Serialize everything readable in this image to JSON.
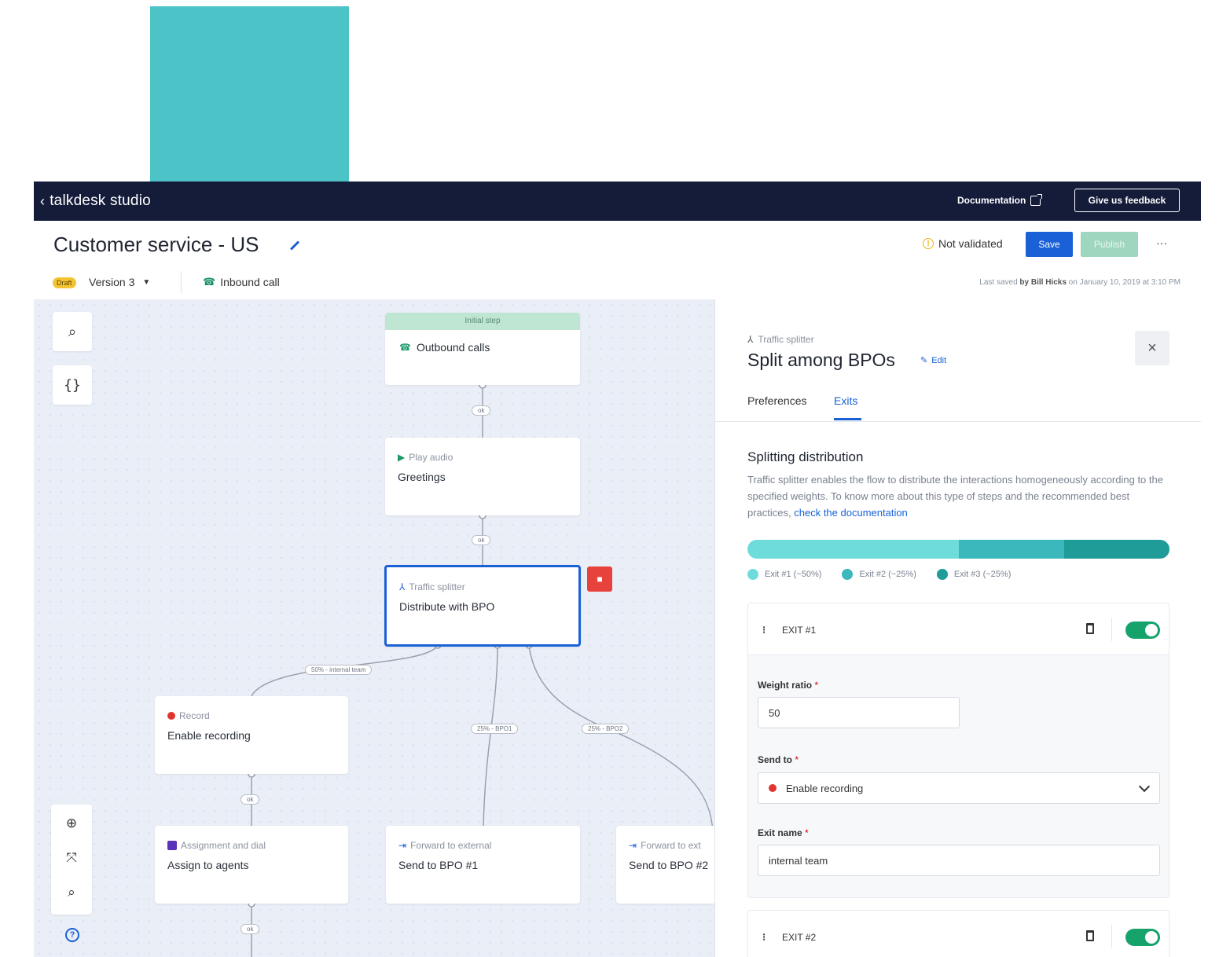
{
  "topbar": {
    "brand": "talkdesk studio",
    "documentation_label": "Documentation",
    "feedback_label": "Give us feedback"
  },
  "header": {
    "title": "Customer service - US",
    "validation_status": "Not validated",
    "save_label": "Save",
    "publish_label": "Publish",
    "more_label": "···",
    "draft_badge": "Draft",
    "version_label": "Version 3",
    "trigger_label": "Inbound call",
    "last_saved_prefix": "Last saved",
    "last_saved_by": "by Bill Hicks",
    "last_saved_when": "on January 10, 2019 at 3:10 PM"
  },
  "colors": {
    "topbar_bg": "#141c3a",
    "accent_blue": "#1a61d8",
    "canvas_bg": "#eaeef6",
    "teal_block": "#4bc3c7",
    "exit1": "#6fdcdc",
    "exit2": "#3bb8bc",
    "exit3": "#1f9c97",
    "toggle_on": "#16a36b",
    "danger": "#e8423d"
  },
  "canvas": {
    "tools": {
      "search_icon": "⌕",
      "variables_icon": "{}",
      "zoom_in_icon": "⊕",
      "fit_icon": "⤧",
      "zoom_out_icon": "⌕",
      "help_icon": "?"
    },
    "nodes": {
      "initial": {
        "header": "Initial step",
        "label": "Outbound calls"
      },
      "play_audio": {
        "type": "Play audio",
        "label": "Greetings"
      },
      "splitter": {
        "type": "Traffic splitter",
        "label": "Distribute with BPO"
      },
      "record": {
        "type": "Record",
        "label": "Enable recording"
      },
      "assign": {
        "type": "Assignment and dial",
        "label": "Assign to agents"
      },
      "forward1": {
        "type": "Forward to external",
        "label": "Send to BPO #1"
      },
      "forward2": {
        "type": "Forward to ext",
        "label": "Send to BPO #2"
      }
    },
    "edge_labels": {
      "ok1": "ok",
      "ok2": "ok",
      "ok3": "ok",
      "ok4": "ok",
      "exit_internal": "50% - internal team",
      "exit_bpo1": "25% - BPO1",
      "exit_bpo2": "25% - BPO2"
    }
  },
  "panel": {
    "type_label": "Traffic splitter",
    "title": "Split among BPOs",
    "edit_label": "Edit",
    "close_label": "×",
    "tabs": [
      {
        "label": "Preferences",
        "active": false
      },
      {
        "label": "Exits",
        "active": true
      }
    ],
    "section_title": "Splitting distribution",
    "section_desc": "Traffic splitter enables the flow to distribute the interactions homogeneously according to the specified weights. To know more about this type of steps and the recommended best practices, ",
    "doc_link": "check the documentation",
    "distribution": [
      {
        "label": "Exit #1 (~50%)",
        "share": 0.5,
        "color": "#6fdcdc"
      },
      {
        "label": "Exit #2 (~25%)",
        "share": 0.25,
        "color": "#3bb8bc"
      },
      {
        "label": "Exit #3 (~25%)",
        "share": 0.25,
        "color": "#1f9c97"
      }
    ],
    "exits": [
      {
        "name": "EXIT #1",
        "enabled": true,
        "weight_label": "Weight ratio",
        "weight_value": "50",
        "send_to_label": "Send to",
        "send_to_value": "Enable recording",
        "exit_name_label": "Exit name",
        "exit_name_value": "internal team"
      },
      {
        "name": "EXIT #2",
        "enabled": true
      }
    ],
    "required_mark": "*"
  }
}
